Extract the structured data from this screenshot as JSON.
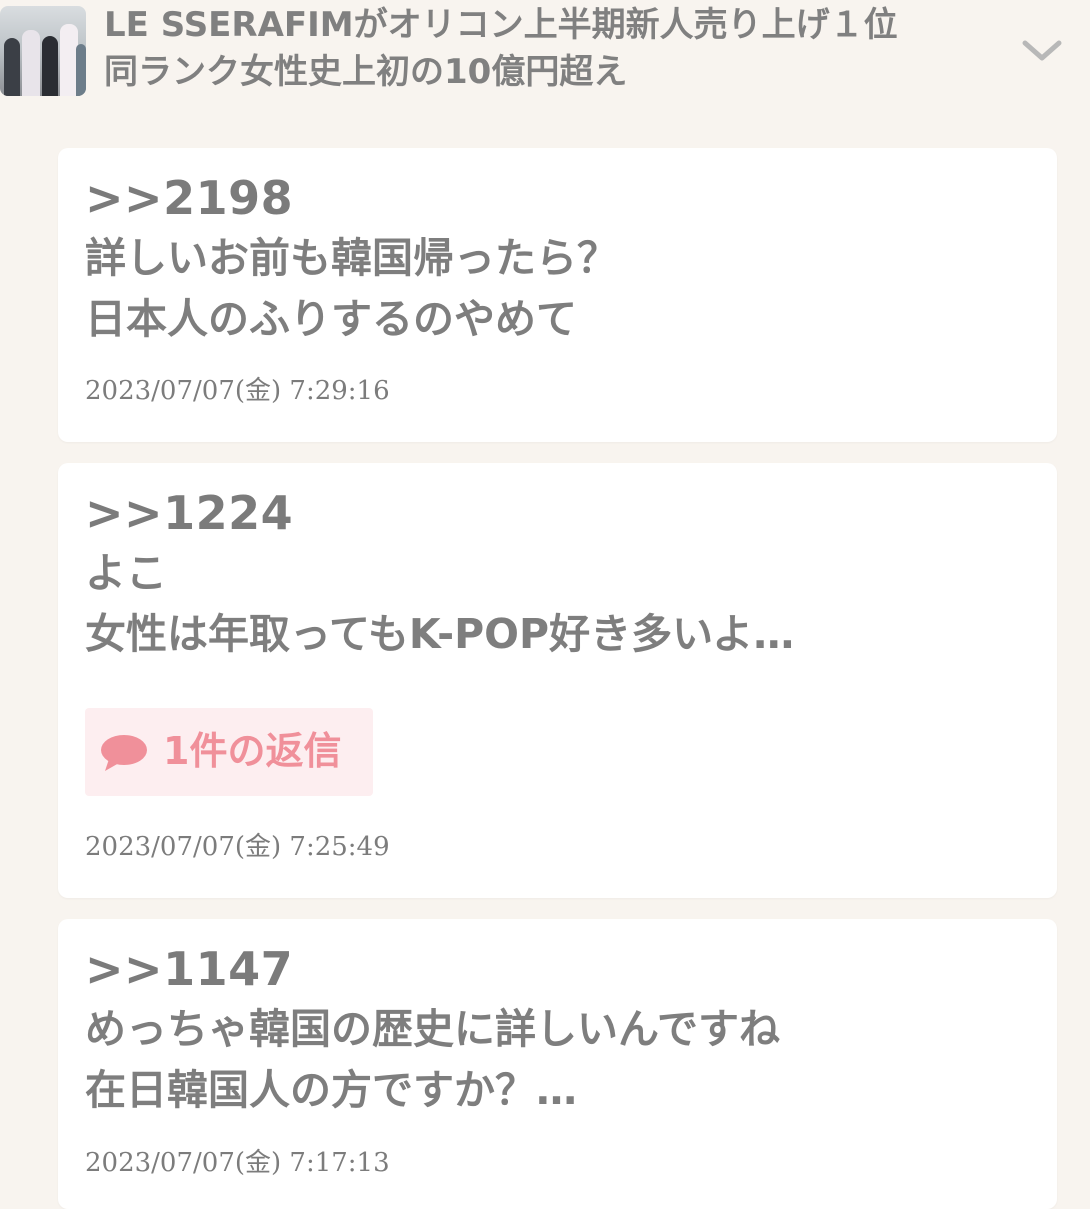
{
  "header": {
    "thumbnail_icon": "group-photo",
    "title_line1": "LE SSERAFIMがオリコン上半期新人売り上げ１位",
    "title_line2": "同ランク女性史上初の10億円超え",
    "expand_icon": "chevron-down-icon"
  },
  "comments": [
    {
      "ref": ">>2198",
      "lines": [
        "詳しいお前も韓国帰ったら？",
        "日本人のふりするのやめて"
      ],
      "timestamp": "2023/07/07(金) 7:29:16"
    },
    {
      "ref": ">>1224",
      "lines": [
        "よこ",
        "女性は年取ってもK-POP好き多いよ…"
      ],
      "reply_label": "1件の返信",
      "reply_icon": "speech-bubble-icon",
      "timestamp": "2023/07/07(金) 7:25:49"
    },
    {
      "ref": ">>1147",
      "lines": [
        "めっちゃ韓国の歴史に詳しいんですね",
        "在日韓国人の方ですか？…"
      ],
      "timestamp": "2023/07/07(金) 7:17:13"
    }
  ],
  "colors": {
    "background": "#f8f4ef",
    "card": "#ffffff",
    "text": "#7e7e7e",
    "reply_bg": "#fdeef0",
    "reply_accent": "#f0909a"
  }
}
